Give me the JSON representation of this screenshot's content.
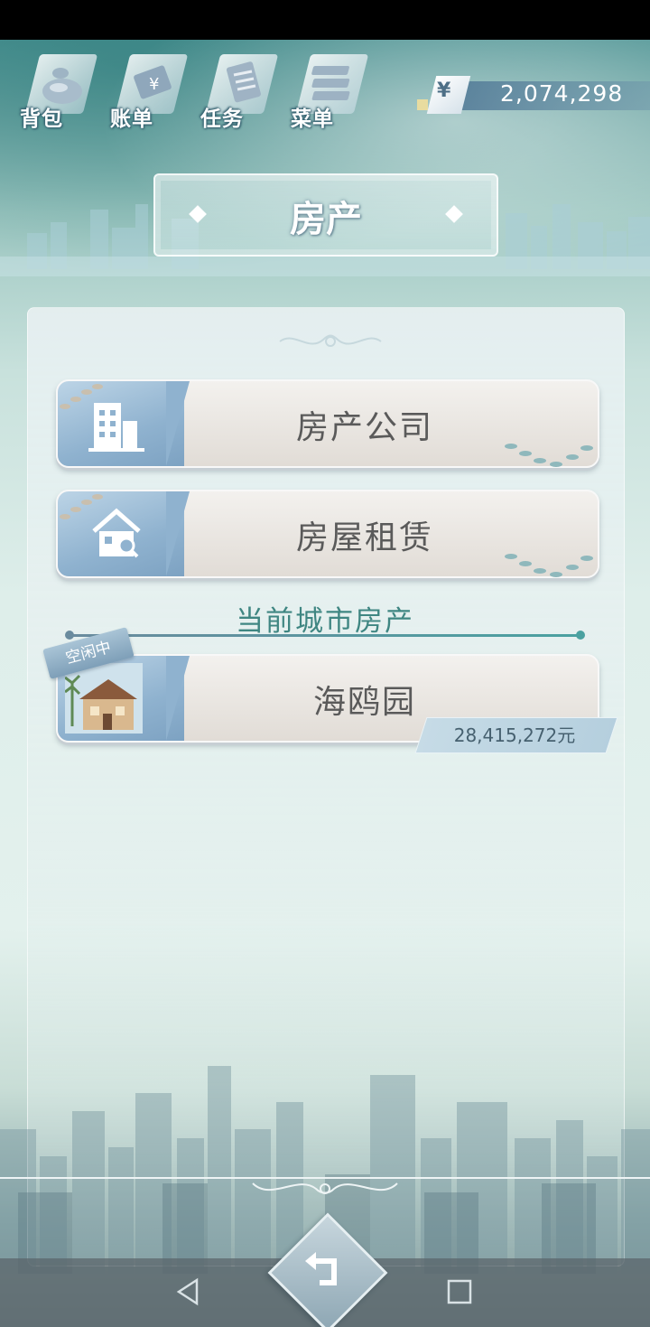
{
  "menu": {
    "items": [
      {
        "label": "背包",
        "icon": "bag-icon"
      },
      {
        "label": "账单",
        "icon": "bill-icon"
      },
      {
        "label": "任务",
        "icon": "task-icon"
      },
      {
        "label": "菜单",
        "icon": "menu-icon"
      }
    ]
  },
  "wallet": {
    "currency_symbol": "¥",
    "amount": "2,074,298"
  },
  "page": {
    "title": "房产"
  },
  "options": [
    {
      "label": "房产公司",
      "icon": "building-icon"
    },
    {
      "label": "房屋租赁",
      "icon": "house-search-icon"
    }
  ],
  "section": {
    "title": "当前城市房产"
  },
  "property": {
    "name": "海鸥园",
    "status": "空闲中",
    "price": "28,415,272元"
  },
  "colors": {
    "accent": "#3f8682",
    "card_blue": "#8fb2cf",
    "text_dark": "#5a5a5a"
  }
}
